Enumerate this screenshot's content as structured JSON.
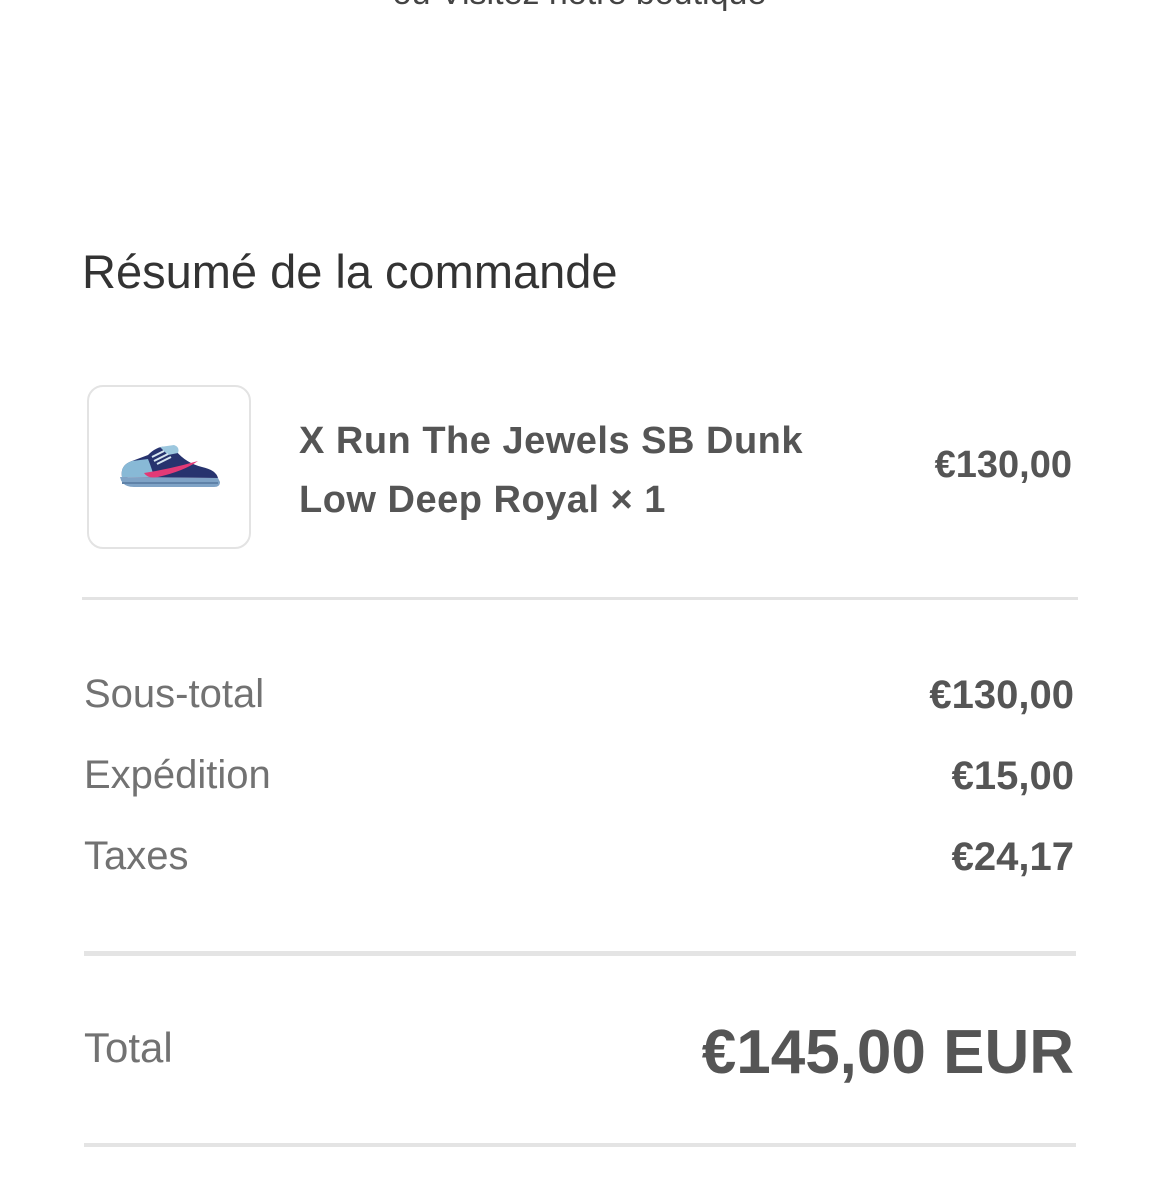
{
  "header": {
    "cutoff_text": "ou Visitez notre boutique"
  },
  "order_summary": {
    "title": "Résumé de la commande",
    "items": [
      {
        "name": "X Run The Jewels SB Dunk Low Deep Royal × 1",
        "price": "€130,00",
        "image_icon": "sneaker-image"
      }
    ],
    "subtotal_label": "Sous-total",
    "subtotal_value": "€130,00",
    "shipping_label": "Expédition",
    "shipping_value": "€15,00",
    "taxes_label": "Taxes",
    "taxes_value": "€24,17",
    "total_label": "Total",
    "total_value": "€145,00 EUR"
  },
  "colors": {
    "text_dark": "#333333",
    "text_medium": "#555555",
    "text_muted": "#727272",
    "divider": "#e3e3e3"
  }
}
